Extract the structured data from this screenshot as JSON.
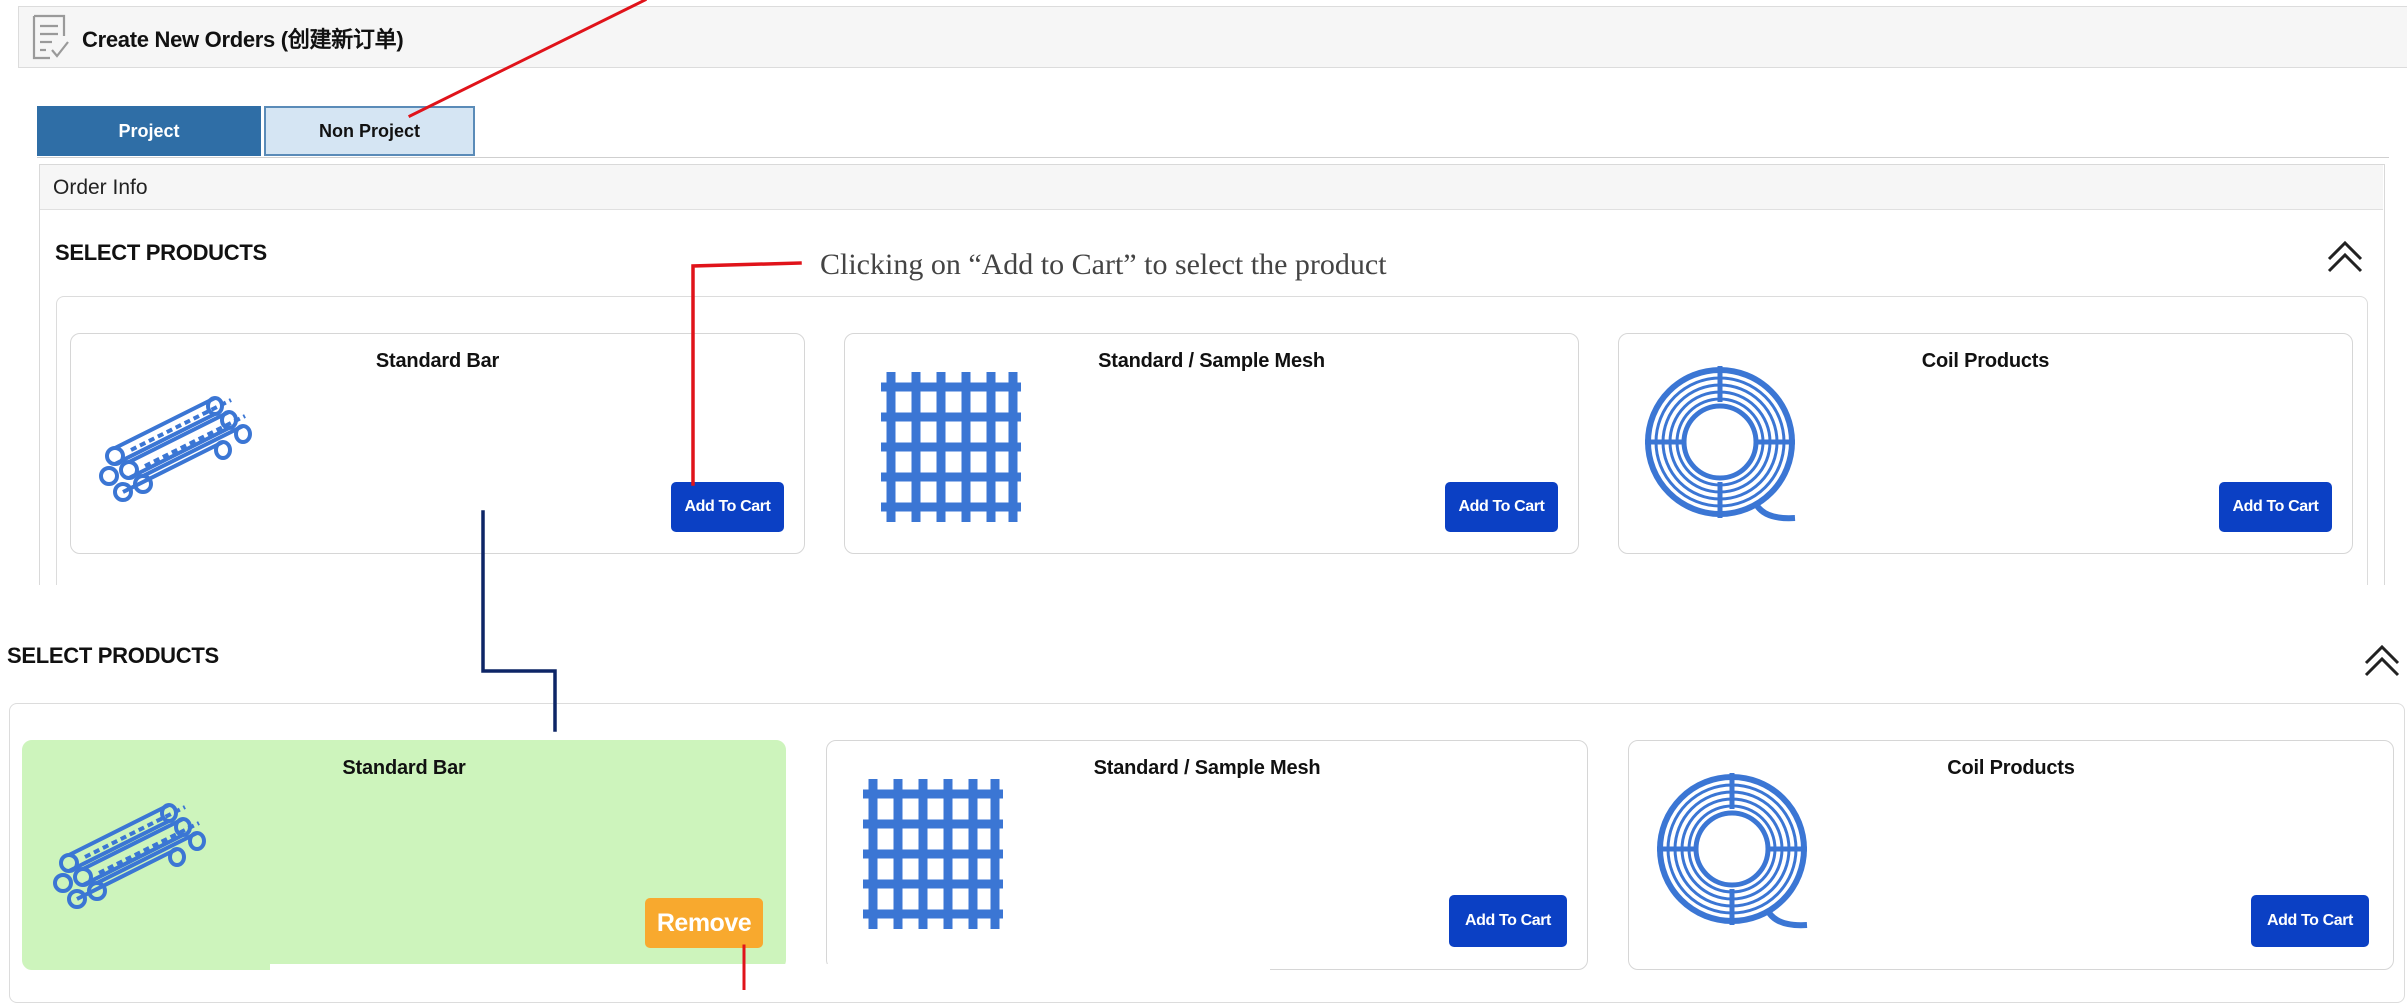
{
  "header": {
    "title": "Create New Orders (创建新订单)",
    "icon": "document-check-icon"
  },
  "tabs": [
    {
      "label": "Project",
      "active": true
    },
    {
      "label": "Non Project",
      "active": false
    }
  ],
  "order_info": {
    "title": "Order Info"
  },
  "annotation": {
    "text": "Clicking on “Add to Cart” to select the product"
  },
  "colors": {
    "accent": "#2f6ea6",
    "button": "#0b40c4",
    "remove": "#f8a92e",
    "selected_card": "#cdf4bc",
    "arrow_red": "#e0131a",
    "arrow_navy": "#0d2566",
    "icon_blue": "#3b76d4"
  },
  "before": {
    "section_title": "SELECT PRODUCTS",
    "products": [
      {
        "name": "Standard Bar",
        "icon": "rebar-bundle-icon",
        "button": "Add To Cart"
      },
      {
        "name": "Standard / Sample Mesh",
        "icon": "mesh-grid-icon",
        "button": "Add To Cart"
      },
      {
        "name": "Coil Products",
        "icon": "coil-icon",
        "button": "Add To Cart"
      }
    ]
  },
  "after": {
    "section_title": "SELECT PRODUCTS",
    "products": [
      {
        "name": "Standard Bar",
        "icon": "rebar-bundle-icon",
        "button": "Remove",
        "selected": true
      },
      {
        "name": "Standard / Sample Mesh",
        "icon": "mesh-grid-icon",
        "button": "Add To Cart"
      },
      {
        "name": "Coil Products",
        "icon": "coil-icon",
        "button": "Add To Cart"
      }
    ]
  }
}
